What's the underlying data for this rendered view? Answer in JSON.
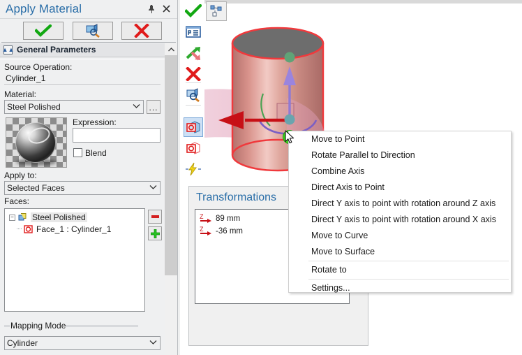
{
  "panel": {
    "title": "Apply Material",
    "pin_icon": "pin-icon",
    "close_icon": "close-icon",
    "toolbar": {
      "ok_label": "OK",
      "preview_label": "Preview",
      "cancel_label": "Cancel"
    },
    "group": {
      "header": "General Parameters",
      "collapse_icon": "chevron-up-icon"
    },
    "fields": {
      "source_operation_label": "Source Operation:",
      "source_operation_value": "Cylinder_1",
      "material_label": "Material:",
      "material_value": "Steel Polished",
      "material_browse_label": "...",
      "expression_label": "Expression:",
      "expression_value": "",
      "blend_label": "Blend",
      "blend_checked": false,
      "apply_to_label": "Apply to:",
      "apply_to_value": "Selected Faces",
      "faces_label": "Faces:",
      "mapping_mode_label": "Mapping Mode",
      "mapping_mode_value": "Cylinder"
    },
    "tree": {
      "root_label": "Steel Polished",
      "child_label": "Face_1 : Cylinder_1"
    },
    "side_buttons": {
      "remove_label": "–",
      "add_label": "+"
    }
  },
  "vertical_toolbar": {
    "items": [
      {
        "name": "apply-check-icon",
        "title": "Apply"
      },
      {
        "name": "properties-icon",
        "title": "Properties"
      },
      {
        "name": "swap-arrows-icon",
        "title": "Swap"
      },
      {
        "name": "delete-x-icon",
        "title": "Delete"
      },
      {
        "name": "preview-magnifier-icon",
        "title": "Preview"
      },
      {
        "name": "cube-selected-icon",
        "title": "Selected Face"
      },
      {
        "name": "cube-outline-icon",
        "title": "Face"
      },
      {
        "name": "lightning-icon",
        "title": "Quick"
      }
    ]
  },
  "viewport": {
    "graph_button_icon": "node-graph-icon",
    "model_name": "Cylinder_1"
  },
  "transformations": {
    "title": "Transformations",
    "items": [
      {
        "axis": "Z",
        "value": "89 mm"
      },
      {
        "axis": "Z",
        "value": "-36 mm"
      }
    ]
  },
  "context_menu": {
    "items": [
      {
        "label": "Move to Point",
        "separator_before": false
      },
      {
        "label": "Rotate Parallel to Direction",
        "separator_before": false
      },
      {
        "label": "Combine Axis",
        "separator_before": false
      },
      {
        "label": "Direct Axis to Point",
        "separator_before": false
      },
      {
        "label": "Direct Y axis to point with rotation around Z axis",
        "separator_before": false
      },
      {
        "label": "Direct Y axis to point with rotation around X axis",
        "separator_before": false
      },
      {
        "label": "Move to Curve",
        "separator_before": false
      },
      {
        "label": "Move to Surface",
        "separator_before": false
      },
      {
        "label": "Rotate to",
        "separator_before": true
      },
      {
        "label": "Settings...",
        "separator_before": true
      }
    ]
  },
  "colors": {
    "accent_blue": "#2a6ea8",
    "panel_bg": "#eff0f1",
    "selection_blue": "#cde0f5",
    "model_red": "#f0393c",
    "axis_purple": "#8f7ad4",
    "handle_green": "#3bd41b",
    "surface_pink": "#e8a6bd"
  }
}
